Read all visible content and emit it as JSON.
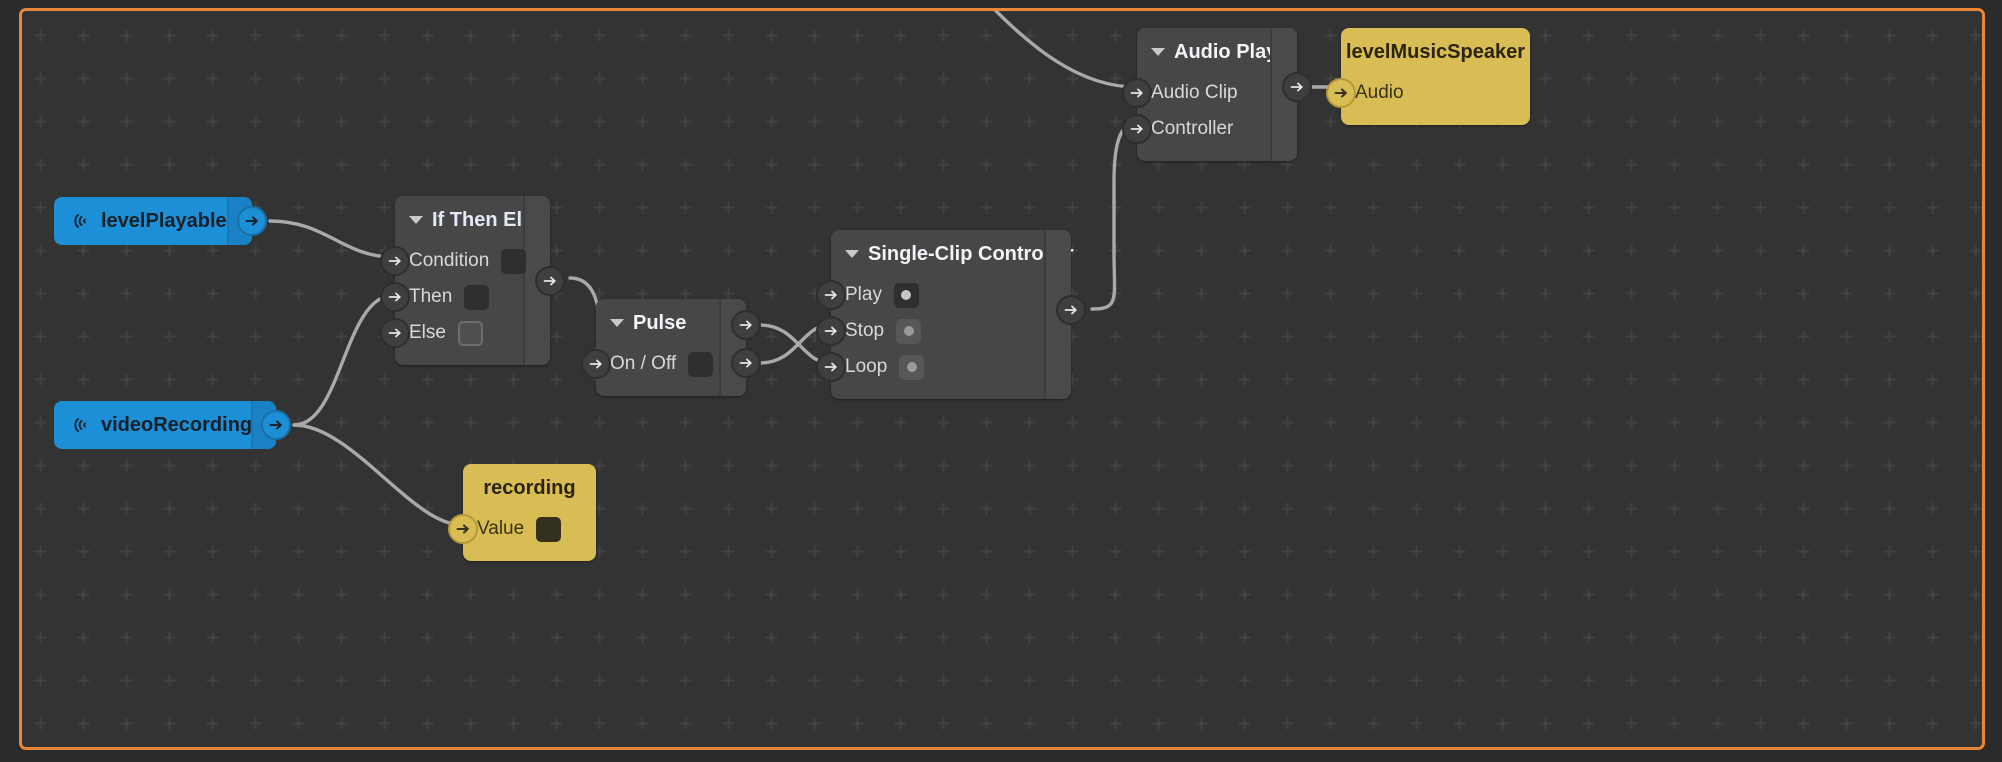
{
  "editor": {
    "name": "visual-script-node-graph",
    "background_color": "#333333",
    "focus_border_color": "#e8873a",
    "wire_color": "#a9a9a9"
  },
  "nodes": {
    "level_playable": {
      "name": "levelPlayable",
      "type": "variable",
      "color": "#1d8fd6",
      "icon": "broadcast-icon",
      "dropdown_icon": "chevron-down-icon",
      "outputs": [
        {
          "label": "",
          "icon": "arrow-right-icon"
        }
      ]
    },
    "video_recording": {
      "name": "videoRecording",
      "type": "variable",
      "color": "#1d8fd6",
      "icon": "broadcast-icon",
      "dropdown_icon": "chevron-down-icon",
      "outputs": [
        {
          "label": "",
          "icon": "arrow-right-icon"
        }
      ]
    },
    "if_then_else": {
      "title": "If Then Else",
      "type": "logic",
      "color": "#474747",
      "collapse_icon": "caret-down-icon",
      "rows": [
        {
          "label": "Condition",
          "widget": "checkbox",
          "state": "filled"
        },
        {
          "label": "Then",
          "widget": "checkbox",
          "state": "filled"
        },
        {
          "label": "Else",
          "widget": "checkbox",
          "state": "outlined"
        }
      ],
      "outputs": 1
    },
    "pulse": {
      "title": "Pulse",
      "type": "logic",
      "color": "#474747",
      "collapse_icon": "caret-down-icon",
      "rows": [
        {
          "label": "On / Off",
          "widget": "checkbox",
          "state": "filled"
        }
      ],
      "outputs": 2
    },
    "single_clip_controller": {
      "title": "Single-Clip Controller",
      "type": "controller",
      "color": "#474747",
      "collapse_icon": "caret-down-icon",
      "rows": [
        {
          "label": "Play",
          "widget": "dot-toggle",
          "state": "active"
        },
        {
          "label": "Stop",
          "widget": "dot-toggle",
          "state": "inactive"
        },
        {
          "label": "Loop",
          "widget": "dot-toggle",
          "state": "inactive"
        }
      ],
      "outputs": 1
    },
    "audio_player": {
      "title": "Audio Player",
      "type": "player",
      "color": "#474747",
      "collapse_icon": "caret-down-icon",
      "rows": [
        {
          "label": "Audio Clip",
          "widget": "none"
        },
        {
          "label": "Controller",
          "widget": "none"
        }
      ],
      "outputs": 1
    },
    "level_music_speaker": {
      "title": "levelMusicSpeaker",
      "type": "component",
      "color": "#d8bd55",
      "rows": [
        {
          "label": "Audio",
          "widget": "none"
        }
      ]
    },
    "recording": {
      "title": "recording",
      "type": "component",
      "color": "#d8bd55",
      "rows": [
        {
          "label": "Value",
          "widget": "checkbox",
          "state": "yellow-dark"
        }
      ]
    }
  }
}
